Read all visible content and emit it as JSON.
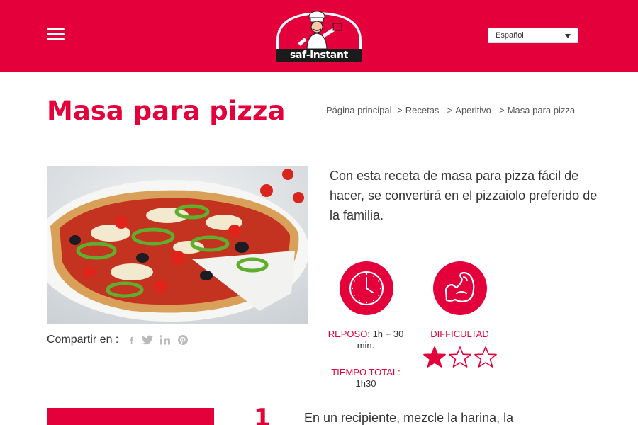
{
  "header": {
    "menu_icon": "hamburger-menu-icon",
    "logo_text": "saf-instant",
    "language": "Español",
    "accent_color": "#e3003b"
  },
  "page": {
    "title": "Masa para pizza"
  },
  "breadcrumb": [
    {
      "label": "Página principal"
    },
    {
      "label": "Recetas"
    },
    {
      "label": "Aperitivo"
    },
    {
      "label": "Masa para pizza"
    }
  ],
  "share": {
    "label": "Compartir en :",
    "icons": [
      "facebook-icon",
      "twitter-icon",
      "linkedin-icon",
      "pinterest-icon"
    ]
  },
  "description": "Con esta receta de masa para pizza fácil de hacer, se convertirá en el pizzaiolo preferido de la familia.",
  "info": {
    "reposo_label": "REPOSO:",
    "reposo_value": "1h + 30 min.",
    "tiempo_label": "TIEMPO TOTAL:",
    "tiempo_value": "1h30",
    "dificultad_label": "DIFFICULTAD",
    "difficulty_rating": 1,
    "difficulty_max": 3
  },
  "steps": [
    {
      "number": "1",
      "text": "En un recipiente, mezcle la harina, la"
    }
  ]
}
